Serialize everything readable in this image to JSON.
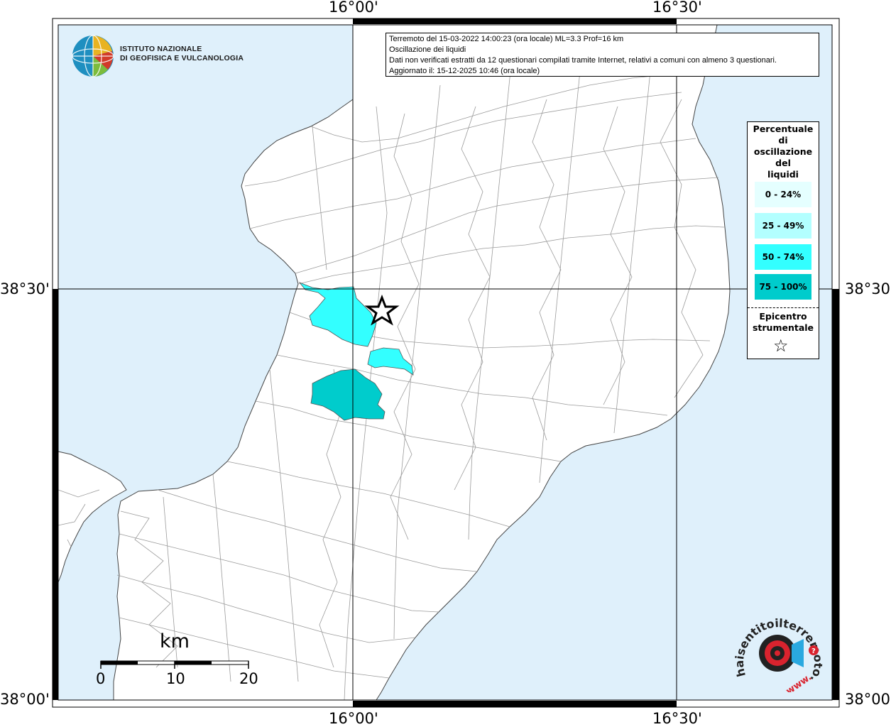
{
  "map": {
    "info": {
      "line1": "Terremoto del 15-03-2022 14:00:23 (ora locale) ML=3.3 Prof=16 km",
      "line2": "Oscillazione dei liquidi",
      "line3": "Dati non verificati estratti da 12 questionari compilati tramite Internet, relativi a comuni con almeno 3 questionari.",
      "line4": "Aggiornato il: 15-12-2025 10:46 (ora locale)"
    },
    "ticks": {
      "lon_west": "16°00'",
      "lon_east": "16°30'",
      "lat_north": "38°30'",
      "lat_south": "38°00'"
    },
    "colors": {
      "sea": "#dff0fb",
      "land": "#ffffff",
      "class_0_24": "#e5ffff",
      "class_25_49": "#b3ffff",
      "class_50_74": "#33ffff",
      "class_75_100": "#00cccc"
    },
    "legend": {
      "title_lines": [
        "Percentuale",
        "di",
        "oscillazione",
        "del",
        "liquidi"
      ],
      "classes": [
        {
          "label": "0 - 24%",
          "color": "#e5ffff"
        },
        {
          "label": "25 - 49%",
          "color": "#b3ffff"
        },
        {
          "label": "50 - 74%",
          "color": "#33ffff"
        },
        {
          "label": "75 - 100%",
          "color": "#00cccc"
        }
      ],
      "epicenter_line1": "Epicentro",
      "epicenter_line2": "strumentale",
      "epicenter_symbol": "star-icon"
    },
    "epicenter": {
      "lat": 38.46,
      "lon": 16.07
    },
    "scale_bar": {
      "title": "km",
      "labels": [
        "0",
        "10",
        "20"
      ]
    },
    "logos": {
      "ingv_line1": "ISTITUTO NAZIONALE",
      "ingv_line2": "DI GEOFISICA E VULCANOLOGIA",
      "hst_text": "haisentitoilterremoto.it",
      "hst_prefix": "www."
    }
  }
}
